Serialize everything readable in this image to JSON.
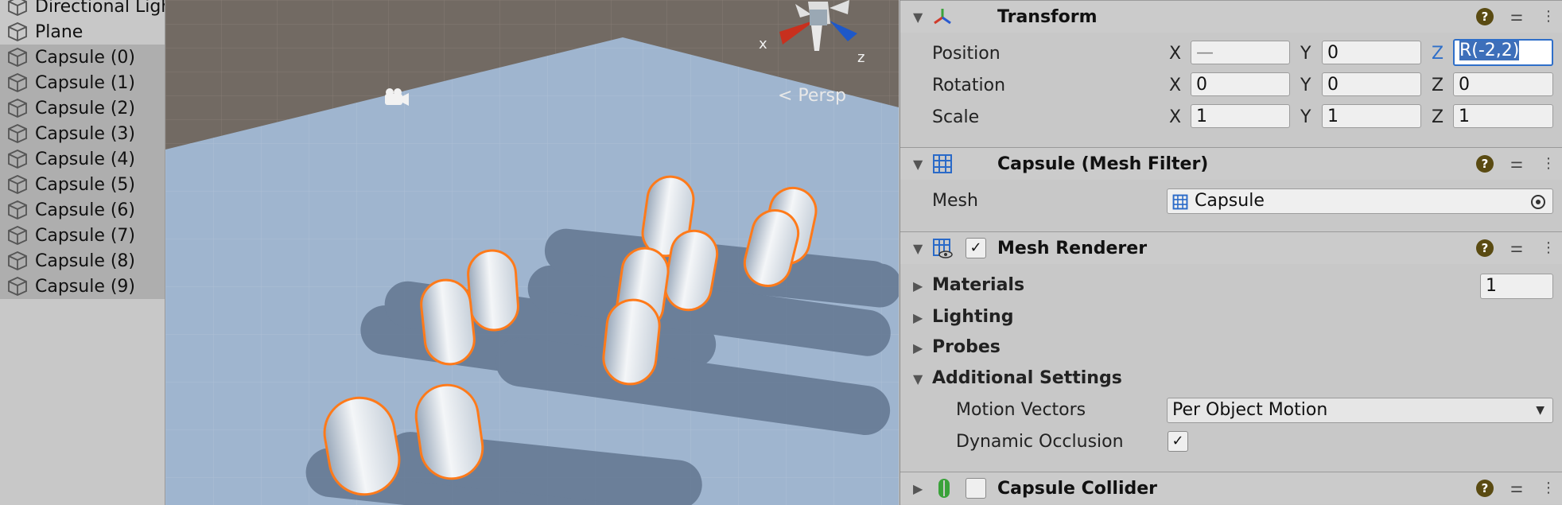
{
  "hierarchy": {
    "items": [
      {
        "label": "Directional Light",
        "selected": false
      },
      {
        "label": "Plane",
        "selected": false
      },
      {
        "label": "Capsule (0)",
        "selected": true
      },
      {
        "label": "Capsule (1)",
        "selected": true
      },
      {
        "label": "Capsule (2)",
        "selected": true
      },
      {
        "label": "Capsule (3)",
        "selected": true
      },
      {
        "label": "Capsule (4)",
        "selected": true
      },
      {
        "label": "Capsule (5)",
        "selected": true
      },
      {
        "label": "Capsule (6)",
        "selected": true
      },
      {
        "label": "Capsule (7)",
        "selected": true
      },
      {
        "label": "Capsule (8)",
        "selected": true
      },
      {
        "label": "Capsule (9)",
        "selected": true
      }
    ]
  },
  "scene": {
    "gizmo_x": "x",
    "gizmo_z": "z",
    "projection_label": "< Persp",
    "ground_color": "#9fb5cf",
    "sky_color": "#726a63",
    "outline_color": "#ff7a1a"
  },
  "inspector": {
    "transform": {
      "title": "Transform",
      "position_label": "Position",
      "rotation_label": "Rotation",
      "scale_label": "Scale",
      "axis_x": "X",
      "axis_y": "Y",
      "axis_z": "Z",
      "position": {
        "x": "—",
        "y": "0",
        "z": "R(-2,2)"
      },
      "rotation": {
        "x": "0",
        "y": "0",
        "z": "0"
      },
      "scale": {
        "x": "1",
        "y": "1",
        "z": "1"
      }
    },
    "mesh_filter": {
      "title": "Capsule (Mesh Filter)",
      "mesh_label": "Mesh",
      "mesh_value": "Capsule"
    },
    "mesh_renderer": {
      "title": "Mesh Renderer",
      "enabled": "✓",
      "materials_label": "Materials",
      "materials_count": "1",
      "lighting_label": "Lighting",
      "probes_label": "Probes",
      "additional_label": "Additional Settings",
      "motion_vectors_label": "Motion Vectors",
      "motion_vectors_value": "Per Object Motion",
      "dynamic_occlusion_label": "Dynamic Occlusion",
      "dynamic_occlusion_value": "✓"
    },
    "capsule_collider": {
      "title": "Capsule Collider"
    }
  }
}
